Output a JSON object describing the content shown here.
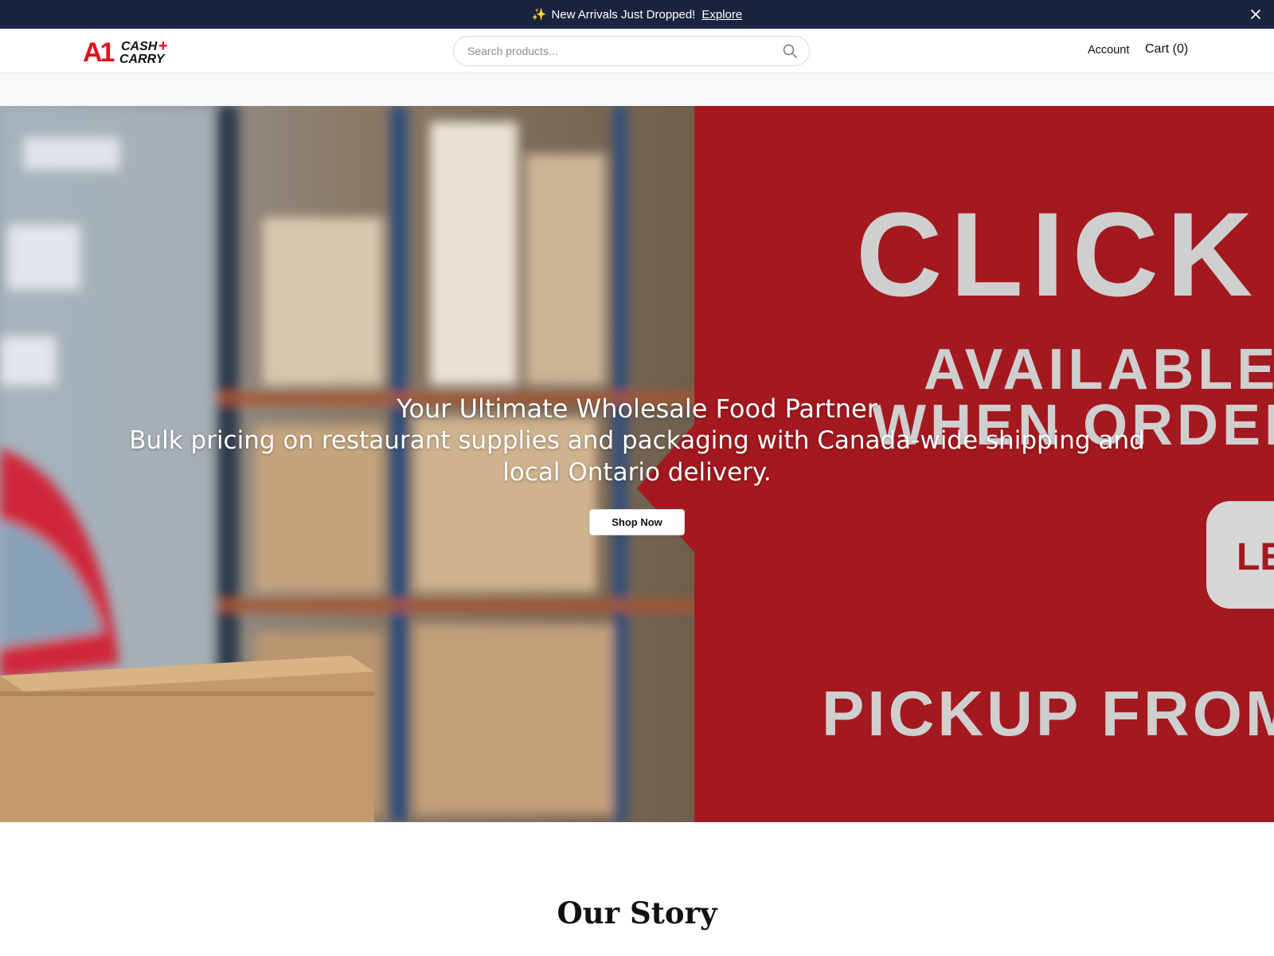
{
  "announcement": {
    "sparkle_icon": "sparkles-icon",
    "message": "New Arrivals Just Dropped!",
    "link_label": "Explore",
    "close_icon": "close-icon"
  },
  "header": {
    "logo": {
      "mark": "A1",
      "line1": "CASH+",
      "line2": "CARRY",
      "brand_red": "#e3101c"
    },
    "search": {
      "placeholder": "Search products...",
      "value": "",
      "icon": "search-icon"
    },
    "account_label": "Account",
    "cart_label": "Cart (0)"
  },
  "hero": {
    "title": "Your Ultimate Wholesale Food Partner",
    "subtitle": "Bulk pricing on restaurant supplies and packaging with Canada-wide shipping and local Ontario delivery.",
    "cta_label": "Shop Now",
    "banner": {
      "line1": "CLICK &",
      "line2": "AVAILABLE AS",
      "line3": "WHEN ORDER IS",
      "button_fragment": "LE",
      "line4": "PICKUP FROM MIS",
      "accent": "#a3191f"
    }
  },
  "story": {
    "title": "Our Story"
  },
  "colors": {
    "announcement_bg": "#1a2340",
    "subnav_bg": "#f7f8fa"
  }
}
